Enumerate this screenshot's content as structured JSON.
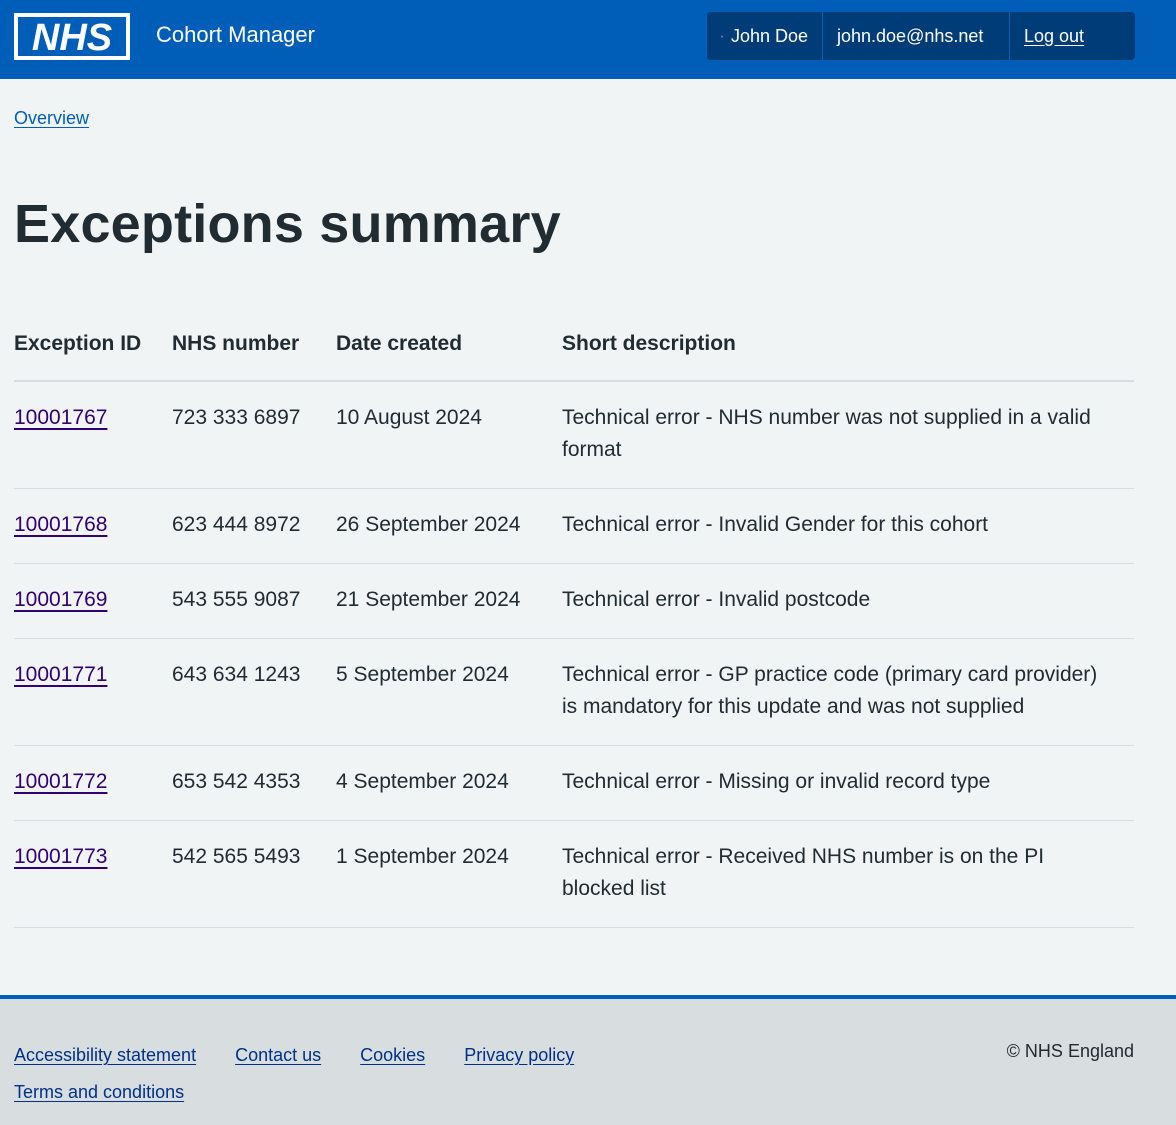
{
  "header": {
    "logo_text": "NHS",
    "service_name": "Cohort Manager",
    "account": {
      "user_name": "John Doe",
      "email": "john.doe@nhs.net",
      "logout_label": "Log out"
    }
  },
  "breadcrumb": {
    "label": "Overview"
  },
  "page": {
    "title": "Exceptions summary"
  },
  "table": {
    "headers": {
      "exception_id": "Exception ID",
      "nhs_number": "NHS number",
      "date_created": "Date created",
      "short_description": "Short description"
    },
    "rows": [
      {
        "exception_id": "10001767",
        "nhs_number": "723 333 6897",
        "date_created": "10 August 2024",
        "short_description": "Technical error - NHS number was not supplied in a valid format"
      },
      {
        "exception_id": "10001768",
        "nhs_number": "623 444 8972",
        "date_created": "26 September 2024",
        "short_description": "Technical error - Invalid Gender for this cohort"
      },
      {
        "exception_id": "10001769",
        "nhs_number": "543 555 9087",
        "date_created": "21 September 2024",
        "short_description": "Technical error - Invalid postcode"
      },
      {
        "exception_id": "10001771",
        "nhs_number": "643 634 1243",
        "date_created": "5 September 2024",
        "short_description": "Technical error - GP practice code (primary card provider) is mandatory for this update and was not supplied"
      },
      {
        "exception_id": "10001772",
        "nhs_number": "653 542 4353",
        "date_created": "4 September 2024",
        "short_description": "Technical error - Missing or invalid record type"
      },
      {
        "exception_id": "10001773",
        "nhs_number": "542 565 5493",
        "date_created": "1 September 2024",
        "short_description": "Technical error - Received NHS number is on the PI blocked list"
      }
    ]
  },
  "footer": {
    "links": {
      "accessibility": "Accessibility statement",
      "contact": "Contact us",
      "cookies": "Cookies",
      "privacy": "Privacy policy",
      "terms": "Terms and conditions"
    },
    "copyright": "© NHS England"
  },
  "colors": {
    "header_blue": "#005eb8",
    "account_bg": "#003d78",
    "page_bg": "#f0f4f5",
    "visited_link": "#330072",
    "footer_bg": "#d8dde0"
  },
  "icons": {
    "user": "user-circle-icon",
    "logo": "nhs-logo"
  }
}
